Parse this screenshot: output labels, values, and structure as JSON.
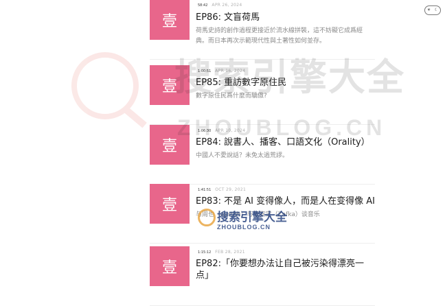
{
  "header": {
    "theme_toggle": {
      "left_glyph": "☀",
      "right_glyph": "☾"
    }
  },
  "colors": {
    "cover": "#e8668b",
    "text_muted": "#8a8a8a",
    "date": "#b0b0b0"
  },
  "episodes": [
    {
      "duration": "58:42",
      "date": "APR 26, 2024",
      "cover_char": "壹",
      "title": "EP86: 文盲荷馬",
      "summary": "荷馬史詩的創作過程更接近於流水線拼裝，這不妨礙它成爲經典。而日本再次示範現代性與土著性如何並存。"
    },
    {
      "duration": "1:00:51",
      "date": "APR 16, 2024",
      "cover_char": "壹",
      "title": "EP85: 重訪數字原住民",
      "summary": "數字原住民爲什麼而驕傲?"
    },
    {
      "duration": "1:06:30",
      "date": "APR 10, 2024",
      "cover_char": "壹",
      "title": "EP84: 說書人、播客、口語文化（Orality）",
      "summary": "中國人不愛說話？未免太過荒謬。"
    },
    {
      "duration": "1:41:51",
      "date": "OCT 29, 2021",
      "cover_char": "壹",
      "title": "EP83: 不是 AI 变得像人，而是人在变得像 AI",
      "summary": "与周也（ayrtbh）与张安定（Zafka）谈音乐"
    },
    {
      "duration": "1:15:12",
      "date": "FEB 28, 2021",
      "cover_char": "壹",
      "title": "EP82:「你要想办法让自己被污染得漂亮一点」"
    }
  ],
  "watermark": {
    "brand": "搜索引擎大全",
    "domain": "ZHOUBLOG.CN",
    "logo_char": "周博"
  }
}
